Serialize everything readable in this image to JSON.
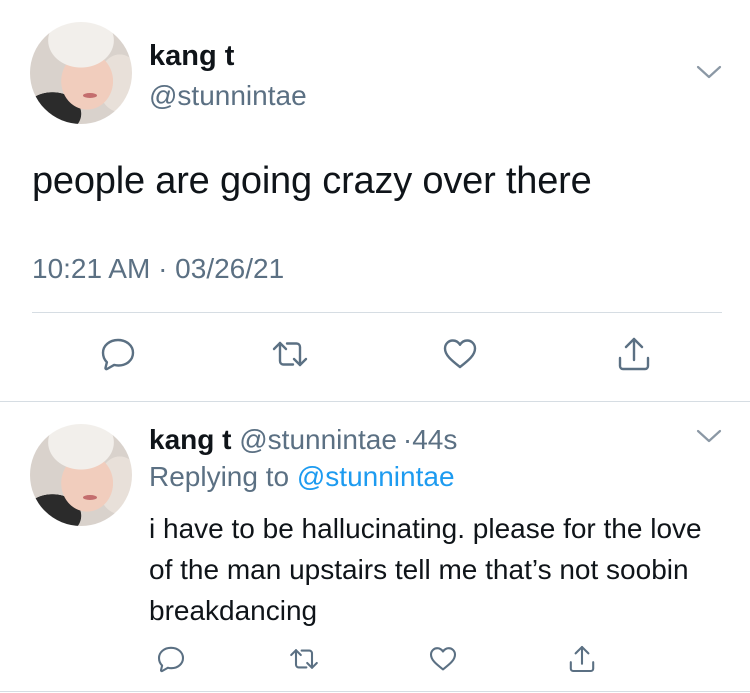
{
  "main_tweet": {
    "author_name": "kang t",
    "author_handle": "@stunnintae",
    "text": "people are going crazy over there",
    "timestamp": "10:21 AM · 03/26/21",
    "actions": [
      "reply-icon",
      "retweet-icon",
      "like-icon",
      "share-icon"
    ]
  },
  "reply_tweet": {
    "author_name": "kang t",
    "author_handle": "@stunnintae",
    "separator": "·",
    "age": "44s",
    "replying_prefix": "Replying to",
    "replying_to": "@stunnintae",
    "text": "i have to be hallucinating. please for the love of the man upstairs tell me that’s not soobin breakdancing",
    "actions": [
      "reply-icon",
      "retweet-icon",
      "like-icon",
      "share-icon"
    ]
  },
  "colors": {
    "text": "#0f1419",
    "secondary": "#5b7083",
    "link": "#1d9bf0",
    "divider": "#d6dde3"
  }
}
